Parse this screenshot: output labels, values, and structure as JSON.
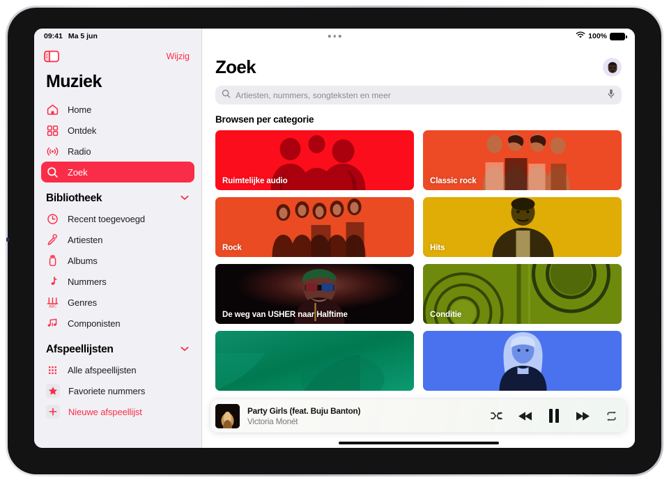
{
  "status_bar": {
    "time": "09:41",
    "date": "Ma 5 jun",
    "wifi_icon": "wifi-icon",
    "battery_percent": "100%",
    "battery_icon": "battery-full-icon",
    "multitask_handle_icon": "multitask-dots-icon"
  },
  "sidebar": {
    "toggle_icon": "sidebar-toggle-icon",
    "edit_label": "Wijzig",
    "title": "Muziek",
    "accent_color": "#fa2d48",
    "background_color": "#f1f1f5",
    "nav": [
      {
        "label": "Home",
        "icon": "house-icon",
        "active": false
      },
      {
        "label": "Ontdek",
        "icon": "grid-squares-icon",
        "active": false
      },
      {
        "label": "Radio",
        "icon": "radio-waves-icon",
        "active": false
      },
      {
        "label": "Zoek",
        "icon": "search-icon",
        "active": true
      }
    ],
    "library": {
      "title": "Bibliotheek",
      "chevron_icon": "chevron-down-icon",
      "items": [
        {
          "label": "Recent toegevoegd",
          "icon": "clock-icon"
        },
        {
          "label": "Artiesten",
          "icon": "microphone-icon"
        },
        {
          "label": "Albums",
          "icon": "album-stack-icon"
        },
        {
          "label": "Nummers",
          "icon": "music-note-icon"
        },
        {
          "label": "Genres",
          "icon": "genres-icon"
        },
        {
          "label": "Componisten",
          "icon": "double-music-note-icon"
        }
      ]
    },
    "playlists": {
      "title": "Afspeellijsten",
      "chevron_icon": "chevron-down-icon",
      "items": [
        {
          "label": "Alle afspeellijsten",
          "icon": "playlist-grid-icon",
          "pink": false
        },
        {
          "label": "Favoriete nummers",
          "icon": "star-icon",
          "pink": false
        },
        {
          "label": "Nieuwe afspeellijst",
          "icon": "plus-icon",
          "pink": true
        }
      ]
    }
  },
  "main": {
    "page_title": "Zoek",
    "avatar_name": "avatar",
    "search": {
      "placeholder": "Artiesten, nummers, songteksten en meer",
      "value": "",
      "search_icon": "search-icon",
      "mic_icon": "microphone-icon"
    },
    "browse_heading": "Browsen per categorie",
    "tiles": [
      {
        "label": "Ruimtelijke audio",
        "color": "#fc0d1b",
        "art": "trio-portrait"
      },
      {
        "label": "Classic rock",
        "color": "#ec4b26",
        "art": "quartet-portrait"
      },
      {
        "label": "Rock",
        "color": "#ea4b22",
        "art": "quintet-portrait"
      },
      {
        "label": "Hits",
        "color": "#e0ac06",
        "art": "solo-portrait"
      },
      {
        "label": "De weg van USHER naar Halftime",
        "color": "#090406",
        "art": "usher-portrait"
      },
      {
        "label": "Conditie",
        "color": "#6d8a0c",
        "art": "weights-photo"
      },
      {
        "label": "",
        "color": "#01875f",
        "art": "teal-gradient"
      },
      {
        "label": "",
        "color": "#4a72ef",
        "art": "blonde-portrait"
      }
    ]
  },
  "player": {
    "track_title": "Party Girls (feat. Buju Banton)",
    "artist": "Victoria Monét",
    "artwork_name": "album-artwork",
    "controls": [
      {
        "name": "shuffle-button",
        "icon": "shuffle-icon"
      },
      {
        "name": "previous-button",
        "icon": "rewind-icon"
      },
      {
        "name": "pause-button",
        "icon": "pause-icon"
      },
      {
        "name": "next-button",
        "icon": "fast-forward-icon"
      },
      {
        "name": "repeat-button",
        "icon": "repeat-icon"
      }
    ]
  }
}
